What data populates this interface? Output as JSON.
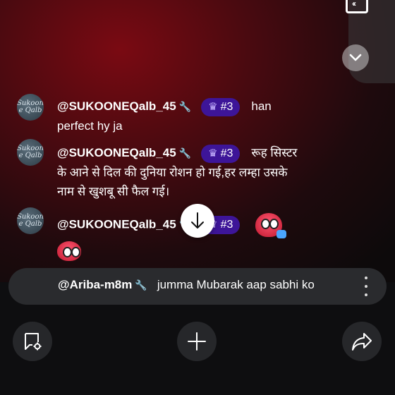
{
  "scroll_top_icon": "chevron-down-icon",
  "top_icon": "quote-box-icon",
  "messages": [
    {
      "avatar_text": [
        "Sukoon",
        "e Qalb"
      ],
      "username": "@SUKOONEQalb_45",
      "badge": "#3",
      "line1": "han",
      "line2": "perfect hy ja"
    },
    {
      "avatar_text": [
        "Sukoon",
        "e Qalb"
      ],
      "username": "@SUKOONEQalb_45",
      "badge": "#3",
      "line1": "रूह सिस्टर",
      "line2": "के आने से दिल की दुनिया रोशन हो गई,हर लम्हा उसके",
      "line3": "नाम से खुशबू सी फैल गई।"
    },
    {
      "avatar_text": [
        "Sukoon",
        "e Qalb"
      ],
      "username": "@SUKOONEQalb_45",
      "badge": "#3"
    }
  ],
  "pinned": {
    "username": "@Ariba-m8m",
    "text": "jumma Mubarak aap sabhi ko"
  },
  "toolbar": {
    "left_icon": "chat-settings-icon",
    "center_icon": "plus-icon",
    "right_icon": "share-icon"
  }
}
